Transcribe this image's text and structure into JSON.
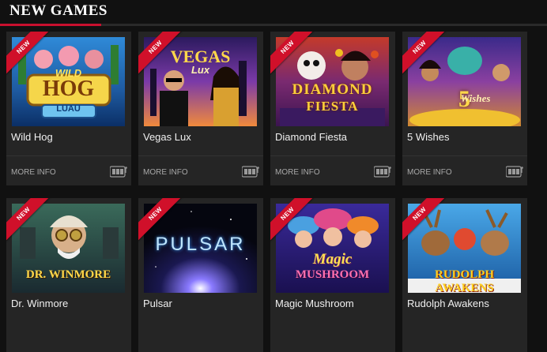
{
  "section": {
    "title": "New Games"
  },
  "badge": "NEW",
  "more_info_label": "MORE INFO",
  "colors": {
    "accent": "#c8102e",
    "card_bg": "#252525",
    "page_bg": "#111111"
  },
  "games": [
    {
      "name": "Wild Hog",
      "logo": [
        "WILD",
        "HOG",
        "LUAU"
      ]
    },
    {
      "name": "Vegas Lux",
      "logo": [
        "VEGAS",
        "Lux",
        ""
      ]
    },
    {
      "name": "Diamond Fiesta",
      "logo": [
        "DIAMOND",
        "FIESTA",
        ""
      ]
    },
    {
      "name": "5 Wishes",
      "logo": [
        "5",
        "Wishes",
        ""
      ]
    },
    {
      "name": "Dr. Winmore",
      "logo": [
        "DR. WINMORE",
        "",
        ""
      ]
    },
    {
      "name": "Pulsar",
      "logo": [
        "PULSAR",
        "",
        ""
      ]
    },
    {
      "name": "Magic Mushroom",
      "logo": [
        "Magic",
        "MUSHROOM",
        ""
      ]
    },
    {
      "name": "Rudolph Awakens",
      "logo": [
        "RUDOLPH",
        "AWAKENS",
        ""
      ]
    }
  ]
}
